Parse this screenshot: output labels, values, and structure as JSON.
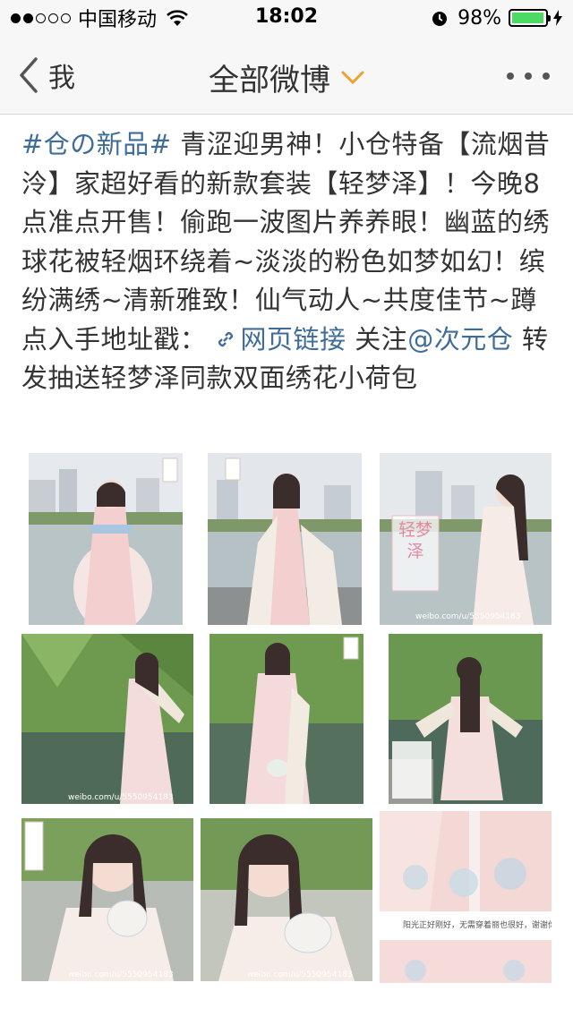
{
  "status_bar": {
    "carrier": "中国移动",
    "time": "18:02",
    "battery": "98%",
    "battery_level": 0.98
  },
  "nav": {
    "back_label": "我",
    "title": "全部微博"
  },
  "post": {
    "hashtag": "#仓の新品#",
    "text_1": " 青涩迎男神！小仓特备【流烟昔泠】家超好看的新款套装【轻梦泽】！今晚8点准点开售！偷跑一波图片养养眼！幽蓝的绣球花被轻烟环绕着~淡淡的粉色如梦如幻！缤纷满绣~清新雅致！仙气动人~共度佳节~蹲点入手地址戳：",
    "link_label": "网页链接",
    "text_2": " 关注",
    "mention": "@次元仓",
    "text_3": " 转发抽送轻梦泽同款双面绣花小荷包"
  },
  "photos": {
    "p3_title": "轻梦泽",
    "watermark_3": "weibo.com/u/5550954183",
    "watermark_4": "weibo.com/u/5550954183",
    "watermark_7": "weibo.com/u/5550954183",
    "watermark_8": "weibo.com/u/5550954183",
    "p9_caption": "阳光正好刚好，无需穿着丽也很好，谢谢你们~"
  }
}
